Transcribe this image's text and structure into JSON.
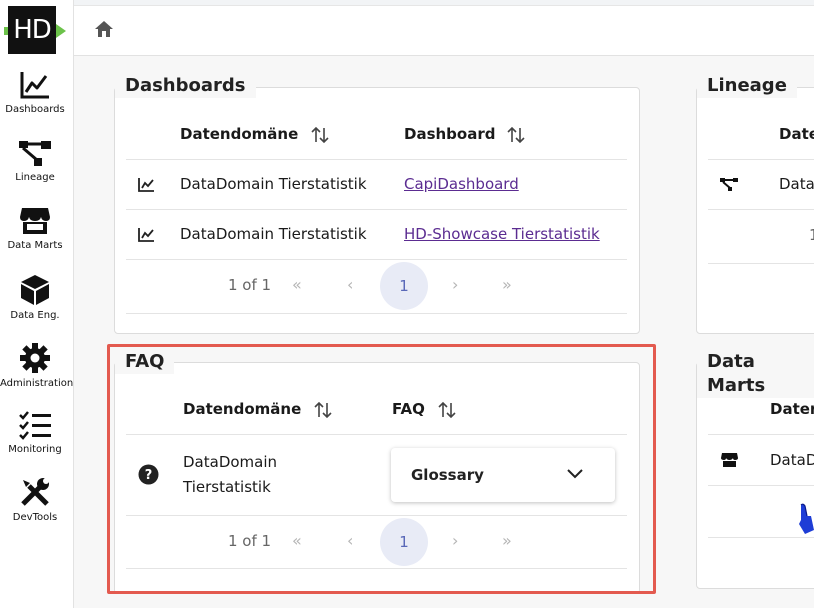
{
  "logo": {
    "text": "HD"
  },
  "sidebar": {
    "items": [
      {
        "label": "Dashboards",
        "icon": "chart-line-icon"
      },
      {
        "label": "Lineage",
        "icon": "lineage-icon"
      },
      {
        "label": "Data Marts",
        "icon": "store-icon"
      },
      {
        "label": "Data Eng.",
        "icon": "cube-icon"
      },
      {
        "label": "Administration",
        "icon": "gear-icon"
      },
      {
        "label": "Monitoring",
        "icon": "checklist-icon"
      },
      {
        "label": "DevTools",
        "icon": "tools-icon"
      }
    ]
  },
  "dashboards": {
    "title": "Dashboards",
    "columns": [
      "Datendomäne",
      "Dashboard"
    ],
    "rows": [
      {
        "domain": "DataDomain Tierstatistik",
        "dashboard": "CapiDashboard"
      },
      {
        "domain": "DataDomain Tierstatistik",
        "dashboard": "HD-Showcase Tierstatistik"
      }
    ],
    "pager": {
      "text": "1 of 1",
      "current": "1"
    }
  },
  "faq": {
    "title": "FAQ",
    "columns": [
      "Datendomäne",
      "FAQ"
    ],
    "rows": [
      {
        "domain_line1": "DataDomain",
        "domain_line2": "Tierstatistik",
        "faq": "Glossary"
      }
    ],
    "pager": {
      "text": "1 of 1",
      "current": "1"
    }
  },
  "lineage": {
    "title": "Lineage",
    "column_partial": "Date",
    "row_partial": "Data",
    "row2_partial": "1"
  },
  "datamarts": {
    "title": "Data Marts",
    "column_partial": "Dater",
    "row_partial": "DataD"
  },
  "pager_glyphs": {
    "first": "«",
    "prev": "‹",
    "next": "›",
    "last": "»"
  },
  "colors": {
    "highlight": "#e35a4f",
    "link": "#5b2c91",
    "pager_active_bg": "#e8ebf6",
    "logo_accent": "#6cc24a"
  }
}
